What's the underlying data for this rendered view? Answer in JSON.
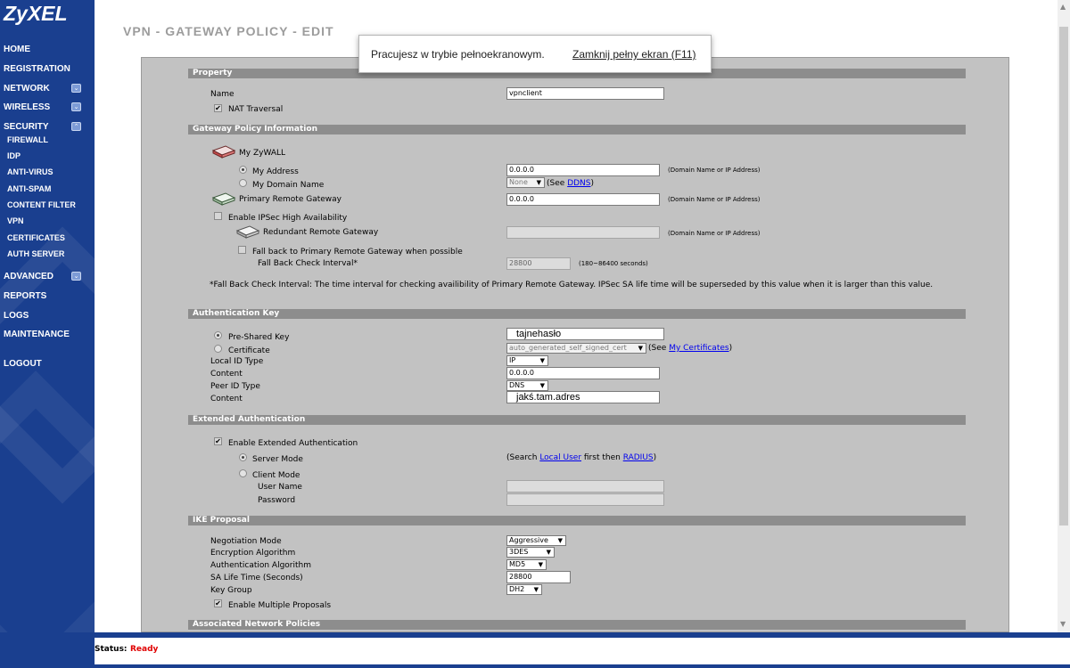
{
  "brand": {
    "logo": "ZyXEL"
  },
  "sidebar": {
    "items": [
      {
        "label": "HOME"
      },
      {
        "label": "REGISTRATION"
      },
      {
        "label": "NETWORK",
        "icon": "expand-icon"
      },
      {
        "label": "WIRELESS",
        "icon": "expand-icon"
      },
      {
        "label": "SECURITY",
        "icon": "collapse-icon"
      },
      {
        "label": "ADVANCED",
        "icon": "expand-icon"
      },
      {
        "label": "REPORTS"
      },
      {
        "label": "LOGS"
      },
      {
        "label": "MAINTENANCE"
      },
      {
        "label": "LOGOUT"
      }
    ],
    "security_sub": [
      "FIREWALL",
      "IDP",
      "ANTI-VIRUS",
      "ANTI-SPAM",
      "CONTENT FILTER",
      "VPN",
      "CERTIFICATES",
      "AUTH SERVER"
    ]
  },
  "page": {
    "title": "VPN - GATEWAY POLICY - EDIT"
  },
  "fullscreen": {
    "message": "Pracujesz w trybie pełnoekranowym.",
    "exit": "Zamknij pełny ekran (F11)"
  },
  "property": {
    "header": "Property",
    "name_label": "Name",
    "name_value": "vpnclient",
    "nat_label": "NAT Traversal",
    "nat_checked": true
  },
  "gateway": {
    "header": "Gateway Policy Information",
    "my_zywall": "My ZyWALL",
    "my_address_label": "My Address",
    "my_address_value": "0.0.0.0",
    "my_address_hint": "(Domain Name or IP Address)",
    "my_domain_label": "My Domain Name",
    "my_domain_select": "None",
    "see": "(See",
    "ddns": "DDNS",
    "close_paren": ")",
    "primary_label": "Primary Remote Gateway",
    "primary_value": "0.0.0.0",
    "primary_hint": "(Domain Name or IP Address)",
    "ha_label": "Enable IPSec High Availability",
    "redundant_label": "Redundant Remote Gateway",
    "redundant_hint": "(Domain Name or IP Address)",
    "fallback_label": "Fall back to Primary Remote Gateway when possible",
    "fallback_interval_label": "Fall Back Check Interval*",
    "fallback_interval_value": "28800",
    "fallback_interval_hint": "(180~86400 seconds)",
    "note": "*Fall Back Check Interval: The time interval for checking availibility of Primary Remote Gateway. IPSec SA life time will be superseded by this value when it is larger than this value."
  },
  "auth_key": {
    "header": "Authentication Key",
    "psk_label": "Pre-Shared Key",
    "psk_value": "tajnehasło",
    "cert_label": "Certificate",
    "cert_select": "auto_generated_self_signed_cert",
    "see": "(See",
    "my_certs": "My Certificates",
    "close_paren": ")",
    "local_id_label": "Local ID Type",
    "local_id_value": "IP",
    "content1_label": "Content",
    "content1_value": "0.0.0.0",
    "peer_id_label": "Peer ID Type",
    "peer_id_value": "DNS",
    "content2_label": "Content",
    "content2_value": "jakś.tam.adres"
  },
  "ext_auth": {
    "header": "Extended Authentication",
    "enable_label": "Enable Extended Authentication",
    "server_mode": "Server Mode",
    "search_prefix": "(Search",
    "local_user": "Local User",
    "first_then": "first then",
    "radius": "RADIUS",
    "close_paren": ")",
    "client_mode": "Client Mode",
    "user_name": "User Name",
    "password": "Password"
  },
  "ike": {
    "header": "IKE Proposal",
    "neg_mode_label": "Negotiation Mode",
    "neg_mode_value": "Aggressive",
    "enc_label": "Encryption Algorithm",
    "enc_value": "3DES",
    "auth_label": "Authentication Algorithm",
    "auth_value": "MD5",
    "sa_label": "SA Life Time (Seconds)",
    "sa_value": "28800",
    "key_group_label": "Key Group",
    "key_group_value": "DH2",
    "multi_label": "Enable Multiple Proposals"
  },
  "assoc": {
    "header": "Associated Network Policies"
  },
  "status": {
    "label": "Status:",
    "value": "Ready"
  },
  "colors": {
    "sidebar": "#1a3f8f",
    "panel": "#c2c2c2",
    "section": "#8d8d8d",
    "status_ready": "#e00000",
    "link": "#0000ee"
  }
}
